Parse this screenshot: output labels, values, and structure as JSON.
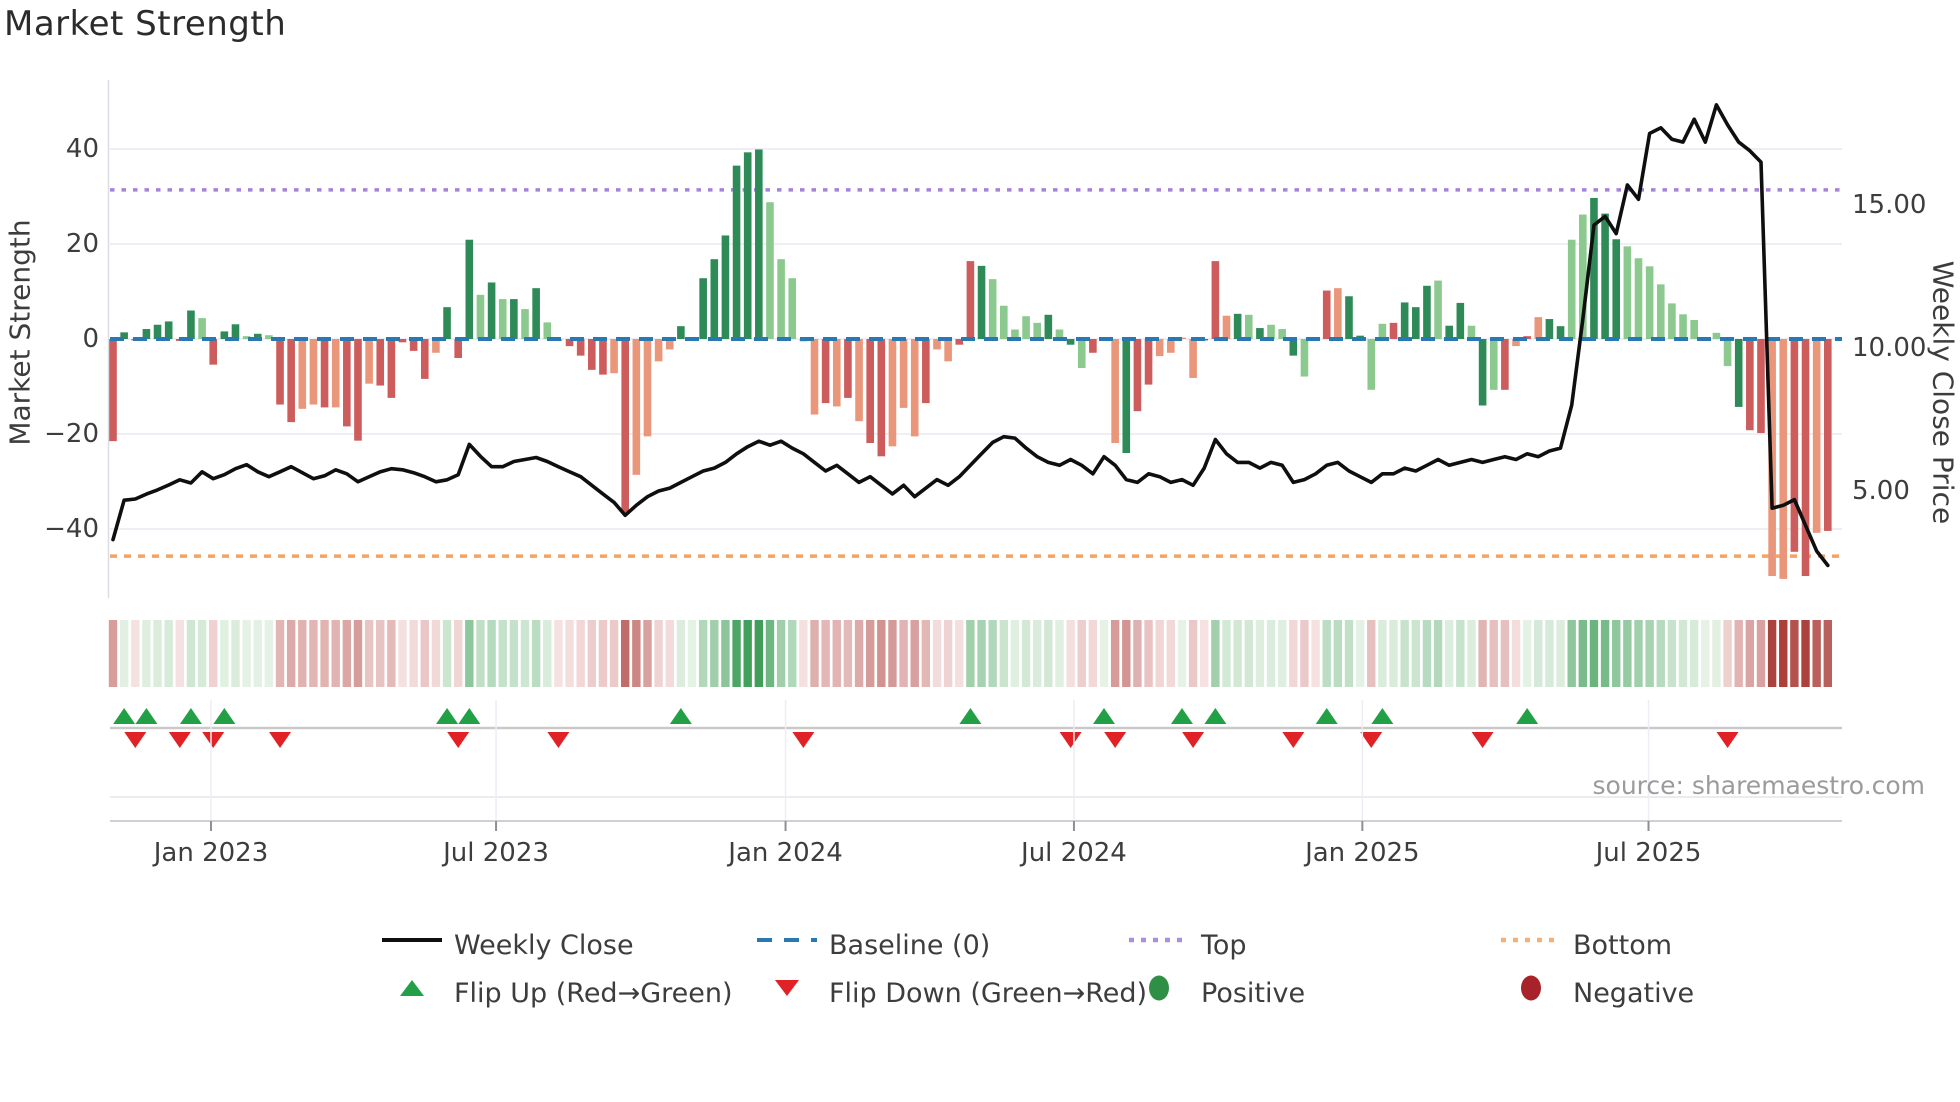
{
  "title": "Market Strength",
  "left_axis": {
    "label": "Market Strength",
    "ticks": [
      "40",
      "20",
      "0",
      "−20",
      "−40"
    ],
    "tick_values": [
      40,
      20,
      0,
      -20,
      -40
    ]
  },
  "right_axis": {
    "label": "Weekly Close Price",
    "ticks": [
      "15.00",
      "10.00",
      "5.00"
    ],
    "tick_values": [
      15,
      10,
      5
    ]
  },
  "x_axis": {
    "ticks": [
      "Jan 2023",
      "Jul 2023",
      "Jan 2024",
      "Jul 2024",
      "Jan 2025",
      "Jul 2025"
    ],
    "tick_week_positions": [
      8.8,
      34.4,
      60.4,
      86.3,
      112.2,
      137.9
    ]
  },
  "source": "source: sharemaestro.com",
  "colors": {
    "bar_dark_green": "#2e8b57",
    "bar_light_green": "#8cc98f",
    "bar_dark_red": "#cd5c5c",
    "bar_salmon": "#e9967a",
    "price_line": "#0f0f0f",
    "baseline_blue": "#2878b4",
    "top_purple": "#a583d9",
    "bottom_orange": "#f4a460",
    "flip_up_green": "#22a045",
    "flip_down_red": "#e02227",
    "positive_dot": "#2e8f45",
    "negative_dot": "#a82329",
    "grid": "#e9e9f1",
    "spine": "#dcdce4"
  },
  "legend": {
    "row1": [
      {
        "label": "Weekly Close",
        "swatch": "line",
        "color": "#0f0f0f"
      },
      {
        "label": "Baseline (0)",
        "swatch": "dashes",
        "color": "#2878b4"
      },
      {
        "label": "Top",
        "swatch": "dots",
        "color": "#a98fdf"
      },
      {
        "label": "Bottom",
        "swatch": "dots",
        "color": "#f3b179"
      }
    ],
    "row2": [
      {
        "label": "Flip Up (Red→Green)",
        "swatch": "triangle-up",
        "color": "#22a045"
      },
      {
        "label": "Flip Down (Green→Red)",
        "swatch": "triangle-down",
        "color": "#e02227"
      },
      {
        "label": "Positive",
        "swatch": "circle",
        "color": "#2e8f45"
      },
      {
        "label": "Negative",
        "swatch": "circle",
        "color": "#a82329"
      }
    ]
  },
  "chart_data": {
    "type": "combo",
    "description": "Weekly market-strength bars (left axis) + weekly close price line (right axis) + heatmap strip + flip markers",
    "weeks": 155,
    "left_ylim": [
      -55,
      52
    ],
    "baseline": 0,
    "top_threshold": 31.4,
    "bottom_threshold": -45.7,
    "series": [
      {
        "name": "Market Strength",
        "type": "bar",
        "axis": "left",
        "values": [
          -21.5,
          1.4,
          -0.3,
          2.1,
          3,
          3.7,
          -0.4,
          6,
          4.4,
          -5.4,
          1.6,
          3.1,
          0.6,
          1.1,
          0.8,
          -13.8,
          -17.5,
          -14.7,
          -13.8,
          -14.4,
          -14.4,
          -18.4,
          -21.4,
          -9.4,
          -9.8,
          -12.4,
          -0.7,
          -2.5,
          -8.4,
          -2.9,
          6.7,
          -4,
          20.9,
          9.3,
          11.9,
          8.4,
          8.4,
          6.3,
          10.7,
          3.5,
          -0.4,
          -1.5,
          -3.5,
          -6.5,
          -7.5,
          -7.2,
          -36.5,
          -28.6,
          -20.5,
          -4.7,
          -2.2,
          2.7,
          0.4,
          12.8,
          16.8,
          21.8,
          36.5,
          39.3,
          39.9,
          28.8,
          16.8,
          12.8,
          -0.5,
          -15.9,
          -13.5,
          -14.2,
          -12.4,
          -17.3,
          -21.9,
          -24.7,
          -22.6,
          -14.5,
          -20.5,
          -13.5,
          -2.2,
          -4.7,
          -1.2,
          16.4,
          15.4,
          12.6,
          7,
          2,
          4.8,
          3.4,
          5.1,
          2,
          -1.2,
          -6.1,
          -2.9,
          0.3,
          -21.9,
          -24,
          -15.2,
          -9.6,
          -3.6,
          -2.9,
          0.3,
          -8.2,
          -0.3,
          16.4,
          4.9,
          5.3,
          5.1,
          2.3,
          3,
          2.1,
          -3.5,
          -7.9,
          -0.3,
          10.2,
          10.7,
          9,
          0.7,
          -10.7,
          3.2,
          3.4,
          7.7,
          6.7,
          11.2,
          12.3,
          2.8,
          7.6,
          2.8,
          -14,
          -10.7,
          -10.7,
          -1.5,
          0.6,
          4.6,
          4.2,
          2.7,
          20.9,
          26.2,
          29.7,
          26.4,
          21,
          19.5,
          17,
          15.3,
          11.5,
          7.5,
          5.2,
          4,
          0.3,
          1.3,
          -5.7,
          -14.3,
          -19.2,
          -19.8,
          -49.9,
          -50.5,
          -44.8,
          -49.9,
          -40.8,
          -40.4
        ],
        "shades": "RGRGGGRGgRGGgGgRRrrRrRRrRRRRRrGRGgGgGgGgrRRRRrRrrrrGGGGGGGGggggrRrRrRRrrrRrrRRGgggggGgGgRRrGRRrrrrGRrGgGggGgRRrGGggRGGGgGGgGgRrRrGGggGGGggggggggggGRRrrRRrRrr"
      },
      {
        "name": "Weekly Close",
        "type": "line",
        "axis": "right",
        "values": [
          3.3,
          4.68,
          4.72,
          4.89,
          5.04,
          5.21,
          5.39,
          5.28,
          5.67,
          5.43,
          5.57,
          5.78,
          5.92,
          5.67,
          5.5,
          5.67,
          5.85,
          5.64,
          5.43,
          5.53,
          5.74,
          5.6,
          5.32,
          5.5,
          5.67,
          5.78,
          5.74,
          5.64,
          5.5,
          5.32,
          5.39,
          5.57,
          6.63,
          6.21,
          5.85,
          5.85,
          6.03,
          6.1,
          6.17,
          6.03,
          5.85,
          5.67,
          5.5,
          5.2,
          4.9,
          4.6,
          4.15,
          4.5,
          4.8,
          5.0,
          5.1,
          5.3,
          5.5,
          5.7,
          5.8,
          6.0,
          6.3,
          6.55,
          6.74,
          6.6,
          6.74,
          6.5,
          6.3,
          6.0,
          5.7,
          5.9,
          5.6,
          5.3,
          5.5,
          5.2,
          4.9,
          5.2,
          4.8,
          5.1,
          5.4,
          5.2,
          5.5,
          5.9,
          6.3,
          6.7,
          6.9,
          6.85,
          6.5,
          6.2,
          6.0,
          5.9,
          6.1,
          5.9,
          5.6,
          6.2,
          5.9,
          5.4,
          5.3,
          5.6,
          5.5,
          5.3,
          5.4,
          5.2,
          5.8,
          6.8,
          6.3,
          6.0,
          6.0,
          5.8,
          6.0,
          5.9,
          5.3,
          5.4,
          5.6,
          5.9,
          6.0,
          5.7,
          5.5,
          5.3,
          5.6,
          5.6,
          5.8,
          5.7,
          5.9,
          6.1,
          5.9,
          6.0,
          6.1,
          6.0,
          6.1,
          6.2,
          6.1,
          6.3,
          6.2,
          6.4,
          6.5,
          8.0,
          11.0,
          14.3,
          14.6,
          14.0,
          15.7,
          15.2,
          17.5,
          17.7,
          17.3,
          17.2,
          18.0,
          17.2,
          18.5,
          17.8,
          17.2,
          16.9,
          16.5,
          4.4,
          4.5,
          4.7,
          3.8,
          2.9,
          2.4
        ]
      }
    ],
    "flip_up_weeks": [
      1,
      3,
      7,
      10,
      30,
      32,
      51,
      77,
      89,
      96,
      99,
      109,
      114,
      127
    ],
    "flip_down_weeks": [
      2,
      6,
      9,
      15,
      31,
      40,
      62,
      86,
      90,
      97,
      106,
      113,
      123,
      145
    ],
    "heatmap": "mirrors bar values with diverging red-green shading"
  }
}
